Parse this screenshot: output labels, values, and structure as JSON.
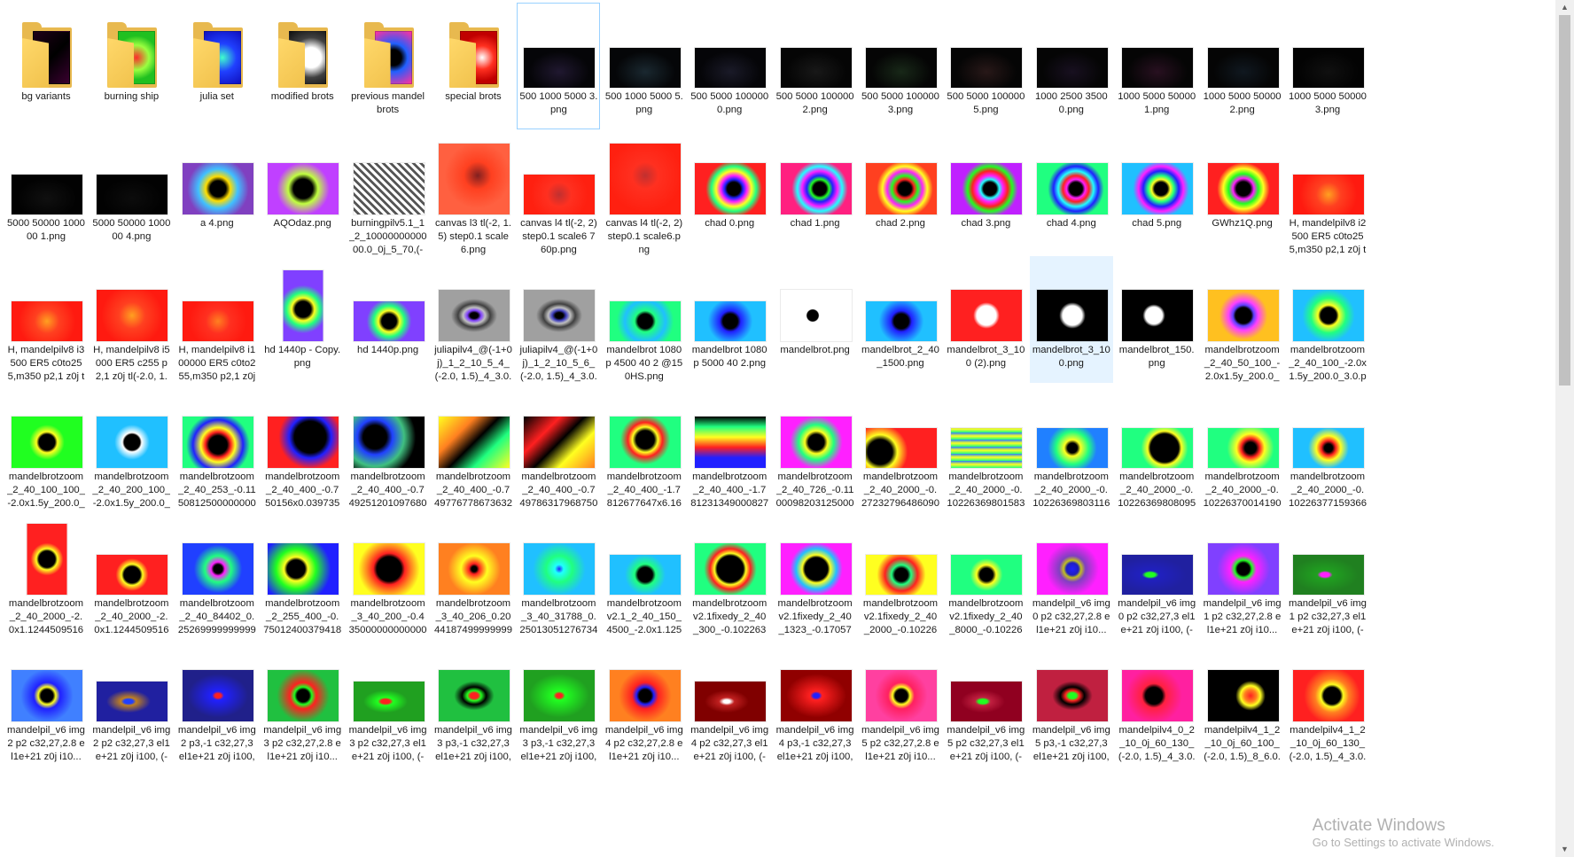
{
  "window": {
    "view": "Large icons"
  },
  "items": [
    {
      "label": "bg variants",
      "type": "folder",
      "fill": "linear-gradient(135deg,#200018,#000,#3a0030)"
    },
    {
      "label": "burning ship",
      "type": "folder",
      "fill": "radial-gradient(circle at 50% 50%,#ff2a2a 0,#9aff40 40%,#20c020 70%)"
    },
    {
      "label": "julia set",
      "type": "folder",
      "fill": "radial-gradient(circle at 50% 50%,#40ffcc 0,#2040ff 45%,#1010c0)"
    },
    {
      "label": "modified brots",
      "type": "folder",
      "fill": "radial-gradient(circle at 60% 50%,#ffffff 0,#ffffff 30%,#404040 60%,#101010)"
    },
    {
      "label": "previous mandelbrots",
      "type": "folder",
      "fill": "radial-gradient(circle at 50% 50%,#000 0,#000 25%,#2060ff 45%,#ff30a0)"
    },
    {
      "label": "special brots",
      "type": "folder",
      "fill": "radial-gradient(circle at 60% 50%,#ffffff 0,#ff3020 35%,#c00000 70%)"
    },
    {
      "label": "500 1000 5000 3.png",
      "w": 80,
      "h": 45,
      "fill": "radial-gradient(ellipse at 50% 60%,#201830 0,#050508 60%)"
    },
    {
      "label": "500 1000 5000 5.png",
      "w": 80,
      "h": 45,
      "fill": "radial-gradient(ellipse at 50% 60%,#1a2830 0,#050608 60%)"
    },
    {
      "label": "500 5000 100000 0.png",
      "w": 80,
      "h": 45,
      "fill": "radial-gradient(ellipse at 50% 60%,#1a1a28 0,#050508 60%)"
    },
    {
      "label": "500 5000 100000 2.png",
      "w": 80,
      "h": 45,
      "fill": "radial-gradient(ellipse at 50% 60%,#181818 0,#050505 60%)"
    },
    {
      "label": "500 5000 100000 3.png",
      "w": 80,
      "h": 45,
      "fill": "radial-gradient(ellipse at 50% 60%,#182818 0,#050505 60%)"
    },
    {
      "label": "500 5000 100000 5.png",
      "w": 80,
      "h": 45,
      "fill": "radial-gradient(ellipse at 50% 60%,#281818 0,#050505 60%)"
    },
    {
      "label": "1000 2500 3500 0.png",
      "w": 80,
      "h": 45,
      "fill": "radial-gradient(ellipse at 50% 60%,#181020 0,#050505 60%)"
    },
    {
      "label": "1000 5000 50000 1.png",
      "w": 80,
      "h": 45,
      "fill": "radial-gradient(ellipse at 50% 60%,#281020 0,#050505 60%)"
    },
    {
      "label": "1000 5000 50000 2.png",
      "w": 80,
      "h": 45,
      "fill": "radial-gradient(ellipse at 50% 60%,#101820 0,#050505 60%)"
    },
    {
      "label": "1000 5000 50000 3.png",
      "w": 80,
      "h": 45,
      "fill": "radial-gradient(ellipse at 50% 60%,#101010 0,#030303 60%)"
    },
    {
      "label": "5000 50000 100000 1.png",
      "w": 80,
      "h": 45,
      "fill": "radial-gradient(ellipse at 50% 60%,#101010 0,#020202 60%)"
    },
    {
      "label": "5000 50000 100000 4.png",
      "w": 80,
      "h": 45,
      "fill": "radial-gradient(ellipse at 50% 60%,#0c0c0c 0,#020202 60%)"
    },
    {
      "label": "a 4.png",
      "w": 80,
      "h": 58,
      "fill": "radial-gradient(circle at 50% 50%,#000 0,#000 18%,#ffdd00 28%,#40c0ff 45%,#8040c0 70%)"
    },
    {
      "label": "AQOdaz.png",
      "w": 80,
      "h": 58,
      "fill": "radial-gradient(circle at 50% 50%,#000 0,#000 22%,#c0ff40 34%,#c040ff 60%)"
    },
    {
      "label": "burningpilv5.1_1_2_1000000000000.0_0j_5_70,(-2.0, 1.5)_4_3.0.png",
      "w": 80,
      "h": 58,
      "fill": "repeating-linear-gradient(45deg,#fff 0,#fff 3px,#555 3px,#555 6px)"
    },
    {
      "label": "canvas l3 tl(-2, 1.5) step0.1 scale6.png",
      "w": 80,
      "h": 80,
      "fill": "radial-gradient(circle at 55% 45%,#802020 0,#ff4020 25%,#ff6040 60%)"
    },
    {
      "label": "canvas l4 tl(-2, 2) step0.1 scale6 760p.png",
      "w": 80,
      "h": 45,
      "fill": "radial-gradient(circle at 50% 50%,#c03030 0,#ff3020 30%,#ff2010 70%)"
    },
    {
      "label": "canvas l4 tl(-2, 2) step0.1 scale6.png",
      "w": 80,
      "h": 80,
      "fill": "radial-gradient(circle at 50% 45%,#c03030 0,#ff3020 25%,#ff2010 70%)"
    },
    {
      "label": "chad 0.png",
      "w": 80,
      "h": 58,
      "fill": "radial-gradient(circle at 55% 50%,#000 0,#000 14%,#2020ff 20%,#ff20ff 28%,#ffff20 38%,#20ff80 48%,#ff2020 60%)"
    },
    {
      "label": "chad 1.png",
      "w": 80,
      "h": 58,
      "fill": "radial-gradient(circle at 55% 50%,#000 0,#000 14%,#20ff20 20%,#2020ff 28%,#ff20ff 38%,#20ffff 48%,#ff2080 60%)"
    },
    {
      "label": "chad 2.png",
      "w": 80,
      "h": 58,
      "fill": "radial-gradient(circle at 55% 50%,#000 0,#000 14%,#ff2020 20%,#20ff20 28%,#ff20ff 38%,#ffff20 48%,#ff4020 60%)"
    },
    {
      "label": "chad 3.png",
      "w": 80,
      "h": 58,
      "fill": "radial-gradient(circle at 55% 50%,#000 0,#000 14%,#20ffff 20%,#ff20ff 28%,#ff2020 38%,#20ff20 48%,#c020ff 60%)"
    },
    {
      "label": "chad 4.png",
      "w": 80,
      "h": 58,
      "fill": "radial-gradient(circle at 55% 50%,#000 0,#000 14%,#ff20ff 20%,#ff2020 28%,#20ffff 38%,#2020ff 48%,#20ff80 60%)"
    },
    {
      "label": "chad 5.png",
      "w": 80,
      "h": 58,
      "fill": "radial-gradient(circle at 55% 50%,#000 0,#000 14%,#ffff20 20%,#20ff80 28%,#2020ff 38%,#ff20ff 48%,#20c0ff 60%)"
    },
    {
      "label": "GWhz1Q.png",
      "w": 80,
      "h": 58,
      "fill": "radial-gradient(circle at 50% 50%,#000 0,#000 16%,#ff20ff 24%,#20ff20 34%,#ffff20 46%,#ff2020 60%)"
    },
    {
      "label": "H, mandelpilv8 i2500 ER5 c0to255,m350 p2,1 z0j tl(-2.0, ...",
      "w": 80,
      "h": 45,
      "fill": "radial-gradient(circle at 50% 50%,#ffa020 0,#ff4020 30%,#ff1a10 70%)"
    },
    {
      "label": "H, mandelpilv8 i3500 ER5 c0to255,m350 p2,1 z0j tl(-2.0, ...",
      "w": 80,
      "h": 45,
      "fill": "radial-gradient(circle at 50% 50%,#ffa020 0,#ff4020 30%,#ff1a10 70%)"
    },
    {
      "label": "H, mandelpilv8 i5000 ER5 c255 p2,1 z0j tl(-2.0, 1.5) w4 3.0.png",
      "w": 80,
      "h": 58,
      "fill": "radial-gradient(circle at 50% 50%,#ffa020 0,#ff4020 30%,#ff1a10 70%)"
    },
    {
      "label": "H, mandelpilv8 i100000 ER5 c0to255,m350 p2,1 z0j tl(-2.0, ...",
      "w": 80,
      "h": 45,
      "fill": "radial-gradient(circle at 50% 50%,#ff8020 0,#ff3020 30%,#ff1a10 70%)"
    },
    {
      "label": "hd 1440p - Copy.png",
      "w": 45,
      "h": 80,
      "fill": "radial-gradient(circle at 50% 55%,#000 0,#000 18%,#ffff20 26%,#20ff80 38%,#8040ff 55%)"
    },
    {
      "label": "hd 1440p.png",
      "w": 80,
      "h": 45,
      "fill": "radial-gradient(circle at 50% 50%,#000 0,#000 18%,#ffff20 26%,#20ff80 38%,#8040ff 55%)"
    },
    {
      "label": "juliapilv4_@(-1+0j)_1_2_10_5_4_(-2.0, 1.5)_4_3.0.png",
      "w": 80,
      "h": 58,
      "fill": "radial-gradient(ellipse at 50% 50%,#000 0,#000 8%,#8040ff 14%,#c0c0c0 22%,#404040 32%,#a0a0a0 46%)"
    },
    {
      "label": "juliapilv4_@(-1+0j)_1_2_10_5_6_(-2.0, 1.5)_4_3.0.png",
      "w": 80,
      "h": 58,
      "fill": "radial-gradient(ellipse at 50% 50%,#000 0,#000 8%,#4040c0 14%,#c0c0c0 22%,#404040 32%,#a0a0a0 46%)"
    },
    {
      "label": "mandelbrot 1080p 4500 40 2 @150HS.png",
      "w": 80,
      "h": 45,
      "fill": "radial-gradient(circle at 50% 50%,#000 0,#000 18%,#20ff80 26%,#20c0ff 50%,#20ff80 70%)"
    },
    {
      "label": "mandelbrot 1080p 5000 40 2.png",
      "w": 80,
      "h": 45,
      "fill": "radial-gradient(circle at 50% 50%,#000 0,#000 18%,#2020ff 26%,#20c0ff 55%)"
    },
    {
      "label": "mandelbrot.png",
      "w": 80,
      "h": 58,
      "fill": "radial-gradient(circle at 45% 50%,#000 0,#000 12%,#ffffff 14%)"
    },
    {
      "label": "mandelbrot_2_40_1500.png",
      "w": 80,
      "h": 45,
      "fill": "radial-gradient(circle at 50% 50%,#000 0,#000 18%,#2020ff 26%,#20c0ff 55%)"
    },
    {
      "label": "mandelbrot_3_100 (2).png",
      "w": 80,
      "h": 58,
      "fill": "radial-gradient(circle at 50% 50%,#fff 0,#fff 22%,#ff2020 30%)"
    },
    {
      "label": "mandelbrot_3_100.png",
      "w": 80,
      "h": 58,
      "fill": "radial-gradient(circle at 50% 50%,#fff 0,#fff 22%,#000 30%)"
    },
    {
      "label": "mandelbrot_150.png",
      "w": 80,
      "h": 58,
      "fill": "radial-gradient(circle at 45% 50%,#fff 0,#fff 18%,#000 24%)"
    },
    {
      "label": "mandelbrotzoom_2_40_50_100_-2.0x1.5y_200.0_3.0.png",
      "w": 80,
      "h": 58,
      "fill": "radial-gradient(circle at 50% 50%,#000 0,#000 18%,#6040ff 24%,#ff40ff 34%,#ffc020 55%)"
    },
    {
      "label": "mandelbrotzoom_2_40_100_-2.0x1.5y_200.0_3.0.png",
      "w": 80,
      "h": 58,
      "fill": "radial-gradient(circle at 50% 50%,#000 0,#000 18%,#ffff20 24%,#20ff80 40%,#20c0ff 60%)"
    },
    {
      "label": "mandelbrotzoom_2_40_100_100_-2.0x1.5y_200.0_3.0.png",
      "w": 80,
      "h": 58,
      "fill": "radial-gradient(circle at 50% 50%,#000 0,#000 18%,#ffff20 24%,#20ff20 40%)"
    },
    {
      "label": "mandelbrotzoom_2_40_200_100_-2.0x1.5y_200.0_3.0.png",
      "w": 80,
      "h": 58,
      "fill": "radial-gradient(circle at 50% 50%,#000 0,#000 18%,#ffffff 22%,#20c0ff 40%)"
    },
    {
      "label": "mandelbrotzoom_2_40_253_-0.11508125000000004x0.901374999999...",
      "w": 80,
      "h": 58,
      "fill": "radial-gradient(circle at 50% 55%,#000 0,#000 20%,#ff2020 28%,#ffff20 38%,#2020ff 55%,#20ff80 70%)"
    },
    {
      "label": "mandelbrotzoom_2_40_400_-0.750156x0.03973574999999993y_5004...",
      "w": 80,
      "h": 58,
      "fill": "radial-gradient(circle at 60% 40%,#000 0,#000 30%,#2020ff 40%,#ff2020 60%)"
    },
    {
      "label": "mandelbrotzoom_2_40_400_-0.7492512010976807x-0.063118713689...",
      "w": 80,
      "h": 58,
      "fill": "radial-gradient(circle at 30% 40%,#000 0,#000 20%,#2040ff 30%,#40c080 50%,#000 70%)"
    },
    {
      "label": "mandelbrotzoom_2_40_400_-0.7497767786736329x0.0395067095009...",
      "w": 80,
      "h": 58,
      "fill": "linear-gradient(135deg,#ffff20 0,#ff8020 30%,#000 50%,#20ff80 70%,#ffff20 100%)"
    },
    {
      "label": "mandelbrotzoom_2_40_400_-0.7497863179687501x0.0395259304687...",
      "w": 80,
      "h": 58,
      "fill": "linear-gradient(135deg,#000 0,#ff2020 30%,#000 50%,#ffff20 70%,#ff8020 100%)"
    },
    {
      "label": "mandelbrotzoom_2_40_400_-1.7812677647x6.162984999985211e-05...",
      "w": 80,
      "h": 58,
      "fill": "radial-gradient(circle at 50% 45%,#000 0,#000 20%,#ffff20 28%,#ff2020 38%,#20ff80 55%)"
    },
    {
      "label": "mandelbrotzoom_2_40_400_-1.7812313490008274x1.4773058130158...",
      "w": 80,
      "h": 58,
      "fill": "linear-gradient(180deg,#000 0,#20ff80 20%,#ffff20 40%,#ff2020 60%,#2020ff 80%)"
    },
    {
      "label": "mandelbrotzoom_2_40_726_-0.11000982031250003x0.895407414062...",
      "w": 80,
      "h": 58,
      "fill": "radial-gradient(circle at 50% 50%,#000 0,#000 18%,#ffff20 26%,#20ff80 40%,#ff20ff 60%)"
    },
    {
      "label": "mandelbrotzoom_2_40_2000_-0.2723279648609078x1.095168374816...",
      "w": 80,
      "h": 45,
      "fill": "radial-gradient(circle at 20% 60%,#000 0,#000 20%,#ffff20 28%,#ff2020 45%)"
    },
    {
      "label": "mandelbrotzoom_2_40_2000_-0.10226369801583692x0.94366553693...",
      "w": 80,
      "h": 45,
      "fill": "repeating-linear-gradient(0deg,#20ff80 0,#ffff20 4px,#2080ff 8px)"
    },
    {
      "label": "mandelbrotzoom_2_40_2000_-0.10226369803116354x0.94366553705...",
      "w": 80,
      "h": 45,
      "fill": "radial-gradient(circle at 50% 50%,#000 0,#000 12%,#ffff20 20%,#20ff80 40%,#2080ff 60%)"
    },
    {
      "label": "mandelbrotzoom_2_40_2000_-0.10226369808095231x0.94366554241...",
      "w": 80,
      "h": 45,
      "fill": "radial-gradient(circle at 60% 50%,#000 0,#000 30%,#ffff20 36%,#20ff80 50%)"
    },
    {
      "label": "mandelbrotzoom_2_40_2000_-0.10226370014190568x0.94366554264...",
      "w": 80,
      "h": 45,
      "fill": "radial-gradient(circle at 60% 50%,#000 0,#000 12%,#ff2020 20%,#ffff20 30%,#20ff80 50%)"
    },
    {
      "label": "mandelbrotzoom_2_40_2000_-0.10226377159366552x0.94366559930...",
      "w": 80,
      "h": 45,
      "fill": "radial-gradient(circle at 50% 50%,#000 0,#000 10%,#ff2020 18%,#ffff20 30%,#20c0ff 50%)"
    },
    {
      "label": "mandelbrotzoom_2_40_2000_-2.0x1.1244509516837482y_341.5_2.24...",
      "w": 45,
      "h": 80,
      "fill": "radial-gradient(circle at 50% 50%,#000 0,#000 20%,#ffff20 26%,#ff2020 40%)"
    },
    {
      "label": "mandelbrotzoom_2_40_2000_-2.0x1.1244509516837482y_341.5_2.24...",
      "w": 80,
      "h": 45,
      "fill": "radial-gradient(circle at 50% 50%,#000 0,#000 20%,#ffff20 26%,#ff2020 40%)"
    },
    {
      "label": "mandelbrotzoom_2_40_84402_0.252699999999999x0.000300000000...",
      "w": 80,
      "h": 58,
      "fill": "radial-gradient(circle at 50% 50%,#000 0,#000 10%,#ff20ff 16%,#20ff80 30%,#2040ff 55%)"
    },
    {
      "label": "mandelbrotzoom_2_255_400_-0.7501240037941894x-0.02956524510...",
      "w": 80,
      "h": 58,
      "fill": "radial-gradient(circle at 40% 50%,#000 0,#000 18%,#ffff20 24%,#20ff20 40%,#2020ff 70%)"
    },
    {
      "label": "mandelbrotzoom_3_40_200_-0.43500000000000005x1.385y_608.3650...",
      "w": 80,
      "h": 58,
      "fill": "radial-gradient(circle at 50% 50%,#000 0,#000 28%,#ff2020 36%,#ff8020 50%,#ffff20 70%)"
    },
    {
      "label": "mandelbrotzoom_3_40_206_0.20441874999999998x1.3061y_6320.675...",
      "w": 80,
      "h": 58,
      "fill": "radial-gradient(circle at 50% 50%,#000 0,#000 6%,#ff2020 12%,#ffff20 30%,#ff8020 60%)"
    },
    {
      "label": "mandelbrotzoom_3_40_31788_0.250130512767343 7x1.240955078613...",
      "w": 80,
      "h": 58,
      "fill": "radial-gradient(circle at 50% 50%,#2020ff 0,#20ffff 10%,#20ff80 30%,#20c0ff 60%)"
    },
    {
      "label": "mandelbrotzoom v2.1_2_40_150_4500_-2.0x1.125y_480.0_2.25.png",
      "w": 80,
      "h": 45,
      "fill": "radial-gradient(circle at 50% 50%,#000 0,#000 18%,#20ff80 26%,#20c0ff 50%)"
    },
    {
      "label": "mandelbrotzoom v2.1fixedy_2_40_300_-0.10226371010694625x0.9436...",
      "w": 80,
      "h": 58,
      "fill": "radial-gradient(circle at 50% 50%,#000 0,#000 30%,#ffff20 36%,#ff2020 46%,#20ff80 60%)"
    },
    {
      "label": "mandelbrotzoom v2.1fixedy_2_40_1323_-0.17057668749999997x-1.07...",
      "w": 80,
      "h": 58,
      "fill": "radial-gradient(circle at 50% 50%,#000 0,#000 26%,#ffff20 32%,#20c0ff 46%,#ff20ff 60%)"
    },
    {
      "label": "mandelbrotzoom v2.1fixedy_2_40_2000_-0.10226371046153276x0.943...",
      "w": 80,
      "h": 45,
      "fill": "radial-gradient(circle at 50% 50%,#000 0,#000 16%,#20ff80 24%,#ff2020 40%,#ffff20 60%)"
    },
    {
      "label": "mandelbrotzoom v2.1fixedy_2_40_8000_-0.10226371046153276x0.943...",
      "w": 80,
      "h": 45,
      "fill": "radial-gradient(circle at 50% 50%,#000 0,#000 16%,#ffff20 24%,#20ff80 40%)"
    },
    {
      "label": "mandelpil_v6 img0 p2 c32,27,2.8 el1e+21 z0j i10...",
      "w": 80,
      "h": 58,
      "fill": "radial-gradient(circle at 50% 50%,#2020ff 0,#2020c0 14%,#c0c020 20%,#8040c0 30%,#ff20ff 60%)"
    },
    {
      "label": "mandelpil_v6 img0 p2 c32,27,3 el1e+21 z0j i100, (-2.5, 2.390625) ...",
      "w": 80,
      "h": 45,
      "fill": "radial-gradient(ellipse at 40% 50%,#20ff20 0,#20ff20 8%,#2020c0 14%,#2020a0 60%)"
    },
    {
      "label": "mandelpil_v6 img1 p2 c32,27,2.8 el1e+21 z0j i10...",
      "w": 80,
      "h": 58,
      "fill": "radial-gradient(circle at 50% 50%,#000 0,#000 14%,#20ff20 20%,#ff20ff 30%,#8040ff 60%)"
    },
    {
      "label": "mandelpil_v6 img1 p2 c32,27,3 el1e+21 z0j i100, (-2.5, 2.390625) ...",
      "w": 80,
      "h": 45,
      "fill": "radial-gradient(ellipse at 45% 50%,#ff20ff 0,#ff20ff 8%,#20a020 14%,#208020 60%)"
    },
    {
      "label": "mandelpil_v6 img2 p2 c32,27,2.8 el1e+21 z0j i10...",
      "w": 80,
      "h": 58,
      "fill": "radial-gradient(circle at 50% 50%,#000 0,#000 14%,#ffff20 20%,#2020ff 30%,#4080ff 60%)"
    },
    {
      "label": "mandelpil_v6 img2 p2 c32,27,3 el1e+21 z0j i100, (-2.5, 2.390625) ...",
      "w": 80,
      "h": 45,
      "fill": "radial-gradient(ellipse at 45% 50%,#2040ff 0,#2040ff 8%,#c08020 14%,#2020a0 40%)"
    },
    {
      "label": "mandelpil_v6 img2 p3,-1 c32,27,3 el1e+21 z0j i100, (-3.5, 2...",
      "w": 80,
      "h": 58,
      "fill": "radial-gradient(ellipse at 50% 50%,#ff2020 0,#ff2020 6%,#2020ff 12%,#20208a 60%)"
    },
    {
      "label": "mandelpil_v6 img3 p2 c32,27,2.8 el1e+21 z0j i10...",
      "w": 80,
      "h": 58,
      "fill": "radial-gradient(circle at 50% 50%,#000 0,#000 14%,#20ff20 20%,#ff2020 30%,#20c040 60%)"
    },
    {
      "label": "mandelpil_v6 img3 p2 c32,27,3 el1e+21 z0j i100, (-2.5, 2.390625) ...",
      "w": 80,
      "h": 45,
      "fill": "radial-gradient(ellipse at 45% 50%,#ff2020 0,#ff2020 8%,#20ff20 14%,#20a020 40%)"
    },
    {
      "label": "mandelpil_v6 img3 p3,-1 c32,27,3 el1e+21 z0j i100, (-2.0, 1...",
      "w": 80,
      "h": 58,
      "fill": "radial-gradient(ellipse at 50% 50%,#ff2020 0,#ff2020 8%,#20ff20 14%,#000 24%,#20c040 40%)"
    },
    {
      "label": "mandelpil_v6 img3 p3,-1 c32,27,3 el1e+21 z0j i100, (-3.5, 2...",
      "w": 80,
      "h": 58,
      "fill": "radial-gradient(ellipse at 50% 50%,#ff2020 0,#ff2020 6%,#20ff20 12%,#20a020 60%)"
    },
    {
      "label": "mandelpil_v6 img4 p2 c32,27,2.8 el1e+21 z0j i10...",
      "w": 80,
      "h": 58,
      "fill": "radial-gradient(circle at 50% 50%,#000 0,#000 14%,#2020ff 20%,#ff2020 30%,#ff8020 60%)"
    },
    {
      "label": "mandelpil_v6 img4 p2 c32,27,3 el1e+21 z0j i100, (-2.5, 2.390625) ...",
      "w": 80,
      "h": 45,
      "fill": "radial-gradient(ellipse at 45% 50%,#ffffff 0,#ffffff 6%,#c02020 14%,#800000 40%)"
    },
    {
      "label": "mandelpil_v6 img4 p3,-1 c32,27,3 el1e+21 z0j i100, (-3.5, 2...",
      "w": 80,
      "h": 58,
      "fill": "radial-gradient(ellipse at 50% 50%,#2020ff 0,#2020ff 6%,#ff2020 12%,#900000 60%)"
    },
    {
      "label": "mandelpil_v6 img5 p2 c32,27,2.8 el1e+21 z0j i10...",
      "w": 80,
      "h": 58,
      "fill": "radial-gradient(circle at 50% 50%,#000 0,#000 14%,#ffff20 20%,#ff2060 30%,#ff40a0 60%)"
    },
    {
      "label": "mandelpil_v6 img5 p2 c32,27,3 el1e+21 z0j i100, (-2.5, 2.390625) ...",
      "w": 80,
      "h": 45,
      "fill": "radial-gradient(ellipse at 45% 50%,#20ff20 0,#20ff20 8%,#c02040 14%,#900020 40%)"
    },
    {
      "label": "mandelpil_v6 img5 p3,-1 c32,27,3 el1e+21 z0j i100, (-2.0, 1...",
      "w": 80,
      "h": 58,
      "fill": "radial-gradient(ellipse at 50% 50%,#20ff20 0,#20ff20 8%,#ff2020 14%,#000 24%,#c02040 40%)"
    },
    {
      "label": "mandelpilv4_0_2_10_0j_60_130_(-2.0, 1.5)_4_3.0.png",
      "w": 80,
      "h": 58,
      "fill": "radial-gradient(circle at 45% 50%,#000 0,#000 18%,#ff2040 26%,#ff20a0 60%)"
    },
    {
      "label": "mandelpilv4_1_2_10_0j_60_100_(-2.0, 1.5)_8_6.0.png",
      "w": 80,
      "h": 58,
      "fill": "radial-gradient(circle at 60% 50%,#ff2020 0,#ff8020 12%,#ffff20 20%,#000 30%)"
    },
    {
      "label": "mandelpilv4_1_2_10_0j_60_130_(-2.0, 1.5)_4_3.0.png",
      "w": 80,
      "h": 58,
      "fill": "radial-gradient(circle at 55% 50%,#000 0,#000 18%,#ffff20 24%,#ff8020 36%,#ff2020 60%)"
    }
  ],
  "scrollbar": {
    "up_glyph": "▲",
    "down_glyph": "▼"
  },
  "watermark": {
    "title": "Activate Windows",
    "subtitle": "Go to Settings to activate Windows."
  }
}
